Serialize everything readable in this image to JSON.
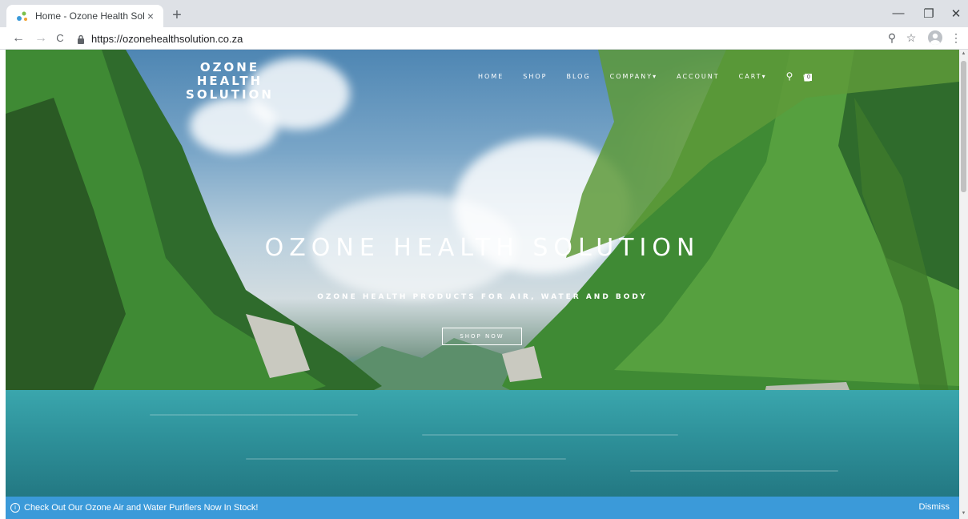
{
  "browser": {
    "tab_title": "Home - Ozone Health Solution",
    "tab_close": "×",
    "new_tab": "+",
    "url": "https://ozonehealthsolution.co.za",
    "controls": {
      "minimize": "—",
      "maximize": "❐",
      "close": "✕"
    },
    "nav": {
      "back": "←",
      "forward": "→",
      "reload": "C"
    },
    "right_icons": {
      "zoom": "⚲",
      "star": "☆",
      "menu": "⋮"
    }
  },
  "site": {
    "logo": "OZONE HEALTH SOLUTION",
    "nav_items": [
      "HOME",
      "SHOP",
      "BLOG",
      "COMPANY",
      "ACCOUNT",
      "CART"
    ],
    "nav_dropdown_marker": "▾",
    "search_icon": "⚲",
    "cart_count": "0",
    "hero_title": "OZONE HEALTH SOLUTION",
    "hero_subtitle": "OZONE HEALTH PRODUCTS FOR AIR, WATER AND BODY",
    "cta_label": "SHOP NOW"
  },
  "notice": {
    "icon": "i",
    "text": "Check Out Our Ozone Air and Water Purifiers Now In Stock!",
    "dismiss": "Dismiss"
  },
  "colors": {
    "notice_bg": "#3b9ad9",
    "tabbar_bg": "#dee1e6"
  }
}
